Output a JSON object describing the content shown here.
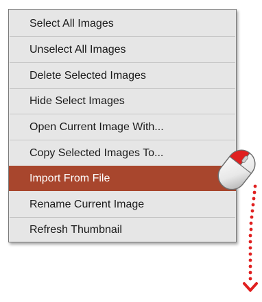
{
  "context_menu": {
    "items": [
      {
        "label": "Select All Images"
      },
      {
        "label": "Unselect All Images"
      },
      {
        "label": "Delete Selected Images"
      },
      {
        "label": "Hide Select Images"
      },
      {
        "label": "Open Current Image With..."
      },
      {
        "label": "Copy Selected Images To..."
      },
      {
        "label": "Import From File",
        "highlighted": true
      },
      {
        "label": "Rename Current Image"
      },
      {
        "label": "Refresh Thumbnail"
      }
    ],
    "highlight_color": "#a8462d",
    "background_color": "#e6e6e6"
  },
  "mouse_illustration": {
    "icon": "mouse-left-click-icon",
    "button_color": "#e02020",
    "trail_icon": "dotted-arrow-down-icon",
    "trail_color": "#e02020"
  }
}
